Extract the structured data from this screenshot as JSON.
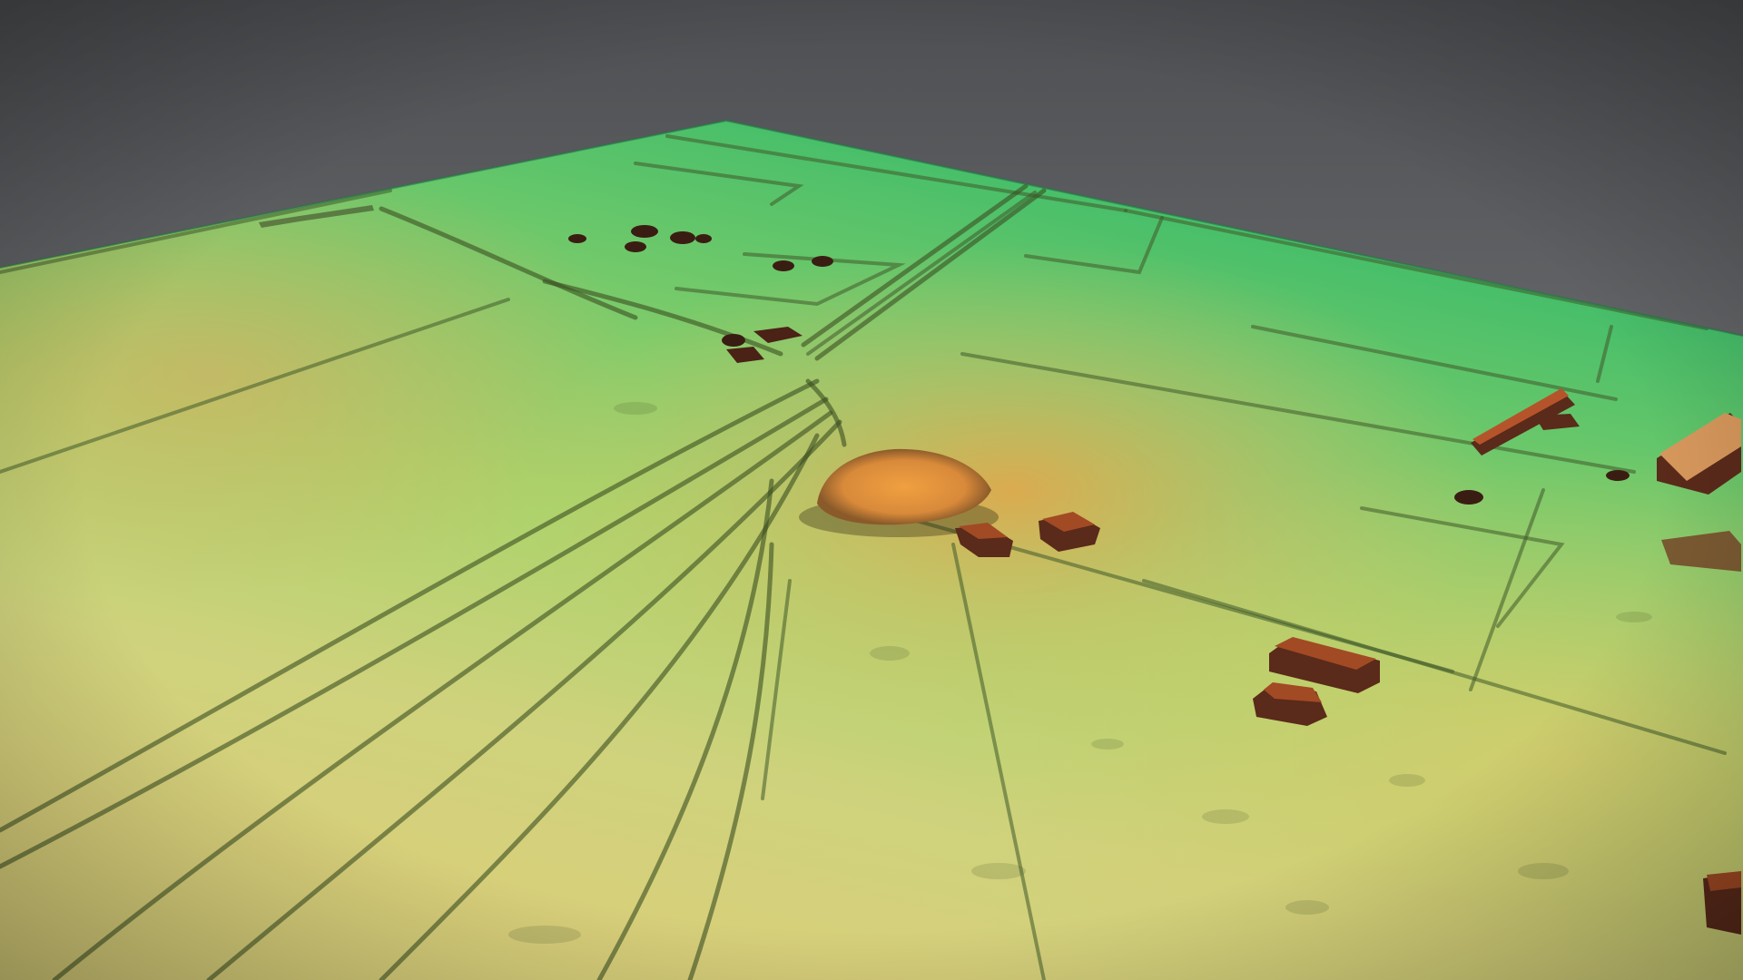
{
  "viewer": {
    "subject": "terrain-elevation-model",
    "colors": {
      "background_top": "#4d4f52",
      "background_bottom": "#8a8c8e",
      "terrain_low": "#2fb86a",
      "terrain_mid": "#a9d36a",
      "terrain_high_mid": "#d8cf7a",
      "terrain_high": "#e6a24a",
      "structure": "#5a2a1a",
      "structure_top": "#b5542a"
    }
  }
}
